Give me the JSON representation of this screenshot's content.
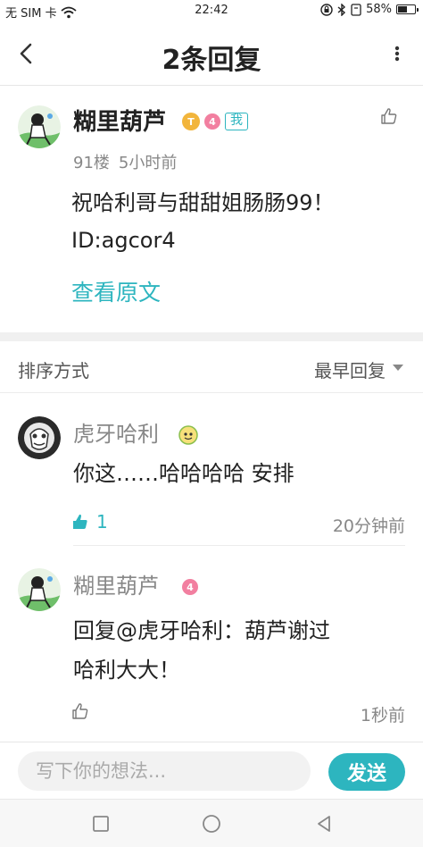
{
  "status_bar": {
    "carrier": "无 SIM 卡",
    "time": "22:42",
    "battery": "58%",
    "battery_level": 0.58,
    "icons": [
      "wifi-icon",
      "lock-rotation-icon",
      "bluetooth-icon",
      "alarm-icon",
      "battery-icon"
    ]
  },
  "header": {
    "title": "2条回复",
    "back_icon": "chevron-left-icon",
    "more_icon": "more-vertical-icon"
  },
  "post": {
    "author": "糊里葫芦",
    "title_badge": "T",
    "level": "4",
    "me_badge": "我",
    "floor": "91楼",
    "time": "5小时前",
    "content_line1": "祝哈利哥与甜甜姐肠肠99！",
    "content_line2": "ID:agcor4",
    "view_original": "查看原文"
  },
  "sort": {
    "label": "排序方式",
    "value": "最早回复"
  },
  "replies": [
    {
      "author": "虎牙哈利",
      "content": "你这……哈哈哈哈 安排",
      "likes": "1",
      "time": "20分钟前"
    },
    {
      "author": "糊里葫芦",
      "level": "4",
      "content_line1": "回复@虎牙哈利：葫芦谢过",
      "content_line2": "哈利大大！",
      "time": "1秒前"
    }
  ],
  "input": {
    "placeholder": "写下你的想法...",
    "send_label": "发送"
  },
  "colors": {
    "accent": "#2db5bf",
    "level_badge": "#f27fa0",
    "title_badge": "#f2b53c",
    "muted_text": "#888888"
  }
}
